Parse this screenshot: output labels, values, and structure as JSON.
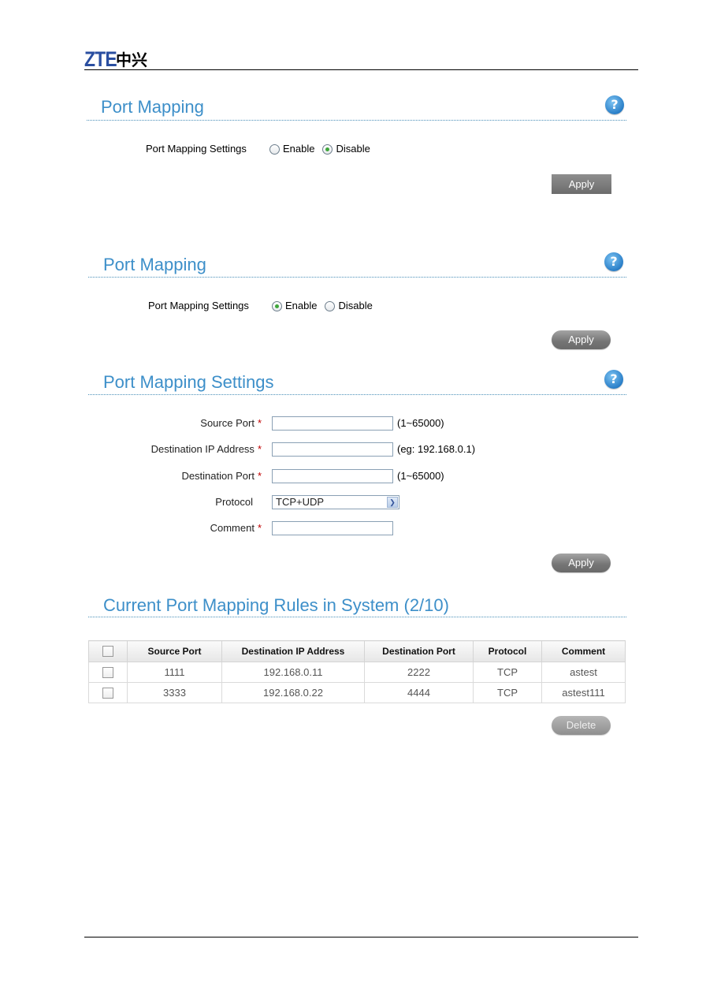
{
  "header": {
    "logo_text": "ZTE",
    "logo_cn": "中兴"
  },
  "section1": {
    "title": "Port Mapping",
    "help_icon": "?",
    "settings_label": "Port Mapping Settings",
    "options": [
      {
        "label": "Enable",
        "checked": false
      },
      {
        "label": "Disable",
        "checked": true
      }
    ],
    "apply_label": "Apply"
  },
  "section2": {
    "title": "Port Mapping",
    "help_icon": "?",
    "settings_label": "Port Mapping Settings",
    "options": [
      {
        "label": "Enable",
        "checked": true
      },
      {
        "label": "Disable",
        "checked": false
      }
    ],
    "apply_label": "Apply"
  },
  "section3": {
    "title": "Port Mapping Settings",
    "help_icon": "?",
    "required_mark": "*",
    "fields": {
      "source_port": {
        "label": "Source Port",
        "value": "",
        "hint": "(1~65000)"
      },
      "dest_ip": {
        "label": "Destination IP Address",
        "value": "",
        "hint": "(eg: 192.168.0.1)"
      },
      "dest_port": {
        "label": "Destination Port",
        "value": "",
        "hint": "(1~65000)"
      },
      "protocol": {
        "label": "Protocol",
        "value": "TCP+UDP"
      },
      "comment": {
        "label": "Comment",
        "value": ""
      }
    },
    "apply_label": "Apply"
  },
  "section4": {
    "title": "Current Port Mapping Rules in System (2/10)",
    "columns": [
      "Source Port",
      "Destination IP Address",
      "Destination Port",
      "Protocol",
      "Comment"
    ],
    "rows": [
      {
        "source_port": "1111",
        "dest_ip": "192.168.0.11",
        "dest_port": "2222",
        "protocol": "TCP",
        "comment": "astest"
      },
      {
        "source_port": "3333",
        "dest_ip": "192.168.0.22",
        "dest_port": "4444",
        "protocol": "TCP",
        "comment": "astest111"
      }
    ],
    "delete_label": "Delete"
  }
}
